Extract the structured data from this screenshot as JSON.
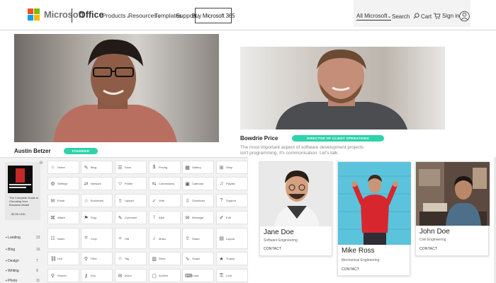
{
  "header": {
    "brand": "Microsoft",
    "office": "Office",
    "nav": [
      "Products",
      "Resources",
      "Templates",
      "Support"
    ],
    "buy": "Buy Microsoft 365",
    "right": [
      "All Microsoft",
      "Search",
      "Cart",
      "Sign in"
    ],
    "logo_colors": [
      "#f25022",
      "#7fba00",
      "#00a4ef",
      "#ffb900"
    ]
  },
  "team": {
    "member1": {
      "name": "Austin Betzer",
      "badge": "FOUNDER"
    },
    "member2": {
      "name": "Bowdrie Price",
      "badge": "DIRECTOR OF CLIENT OPERATIONS",
      "desc": "The most important aspect of software development projects isn't programming, it's communication. Let's talk."
    },
    "accent": "#2ed3a9"
  },
  "dock": {
    "book_title": "LEARN TO CHOOSE THE RIGHT MODEL FOR YOUR BUSINESS",
    "book_desc": "The Complete Guide to Choosing Your Business Model",
    "book_price": "$3.99 USD",
    "sidebar": [
      {
        "label": "Landing",
        "count": "22"
      },
      {
        "label": "Blog",
        "count": "15"
      },
      {
        "label": "Design",
        "count": "7"
      },
      {
        "label": "Writing",
        "count": "9"
      },
      {
        "label": "Photo",
        "count": "11"
      }
    ],
    "tiles": [
      [
        "Home",
        "Blog",
        "Docs",
        "Pricing",
        "Gallery",
        "Shop"
      ],
      [
        "Settings",
        "Network",
        "Profile",
        "Connections",
        "Calendar",
        "Playlist"
      ],
      [
        "Email",
        "Bookmark",
        "Upload",
        "Vote",
        "Download",
        "Support"
      ],
      [
        "Attach",
        "Flag",
        "Comment",
        "Alert",
        "Message",
        "Edit"
      ],
      [
        "Notes",
        "Crop",
        "Gift",
        "Music",
        "Share",
        "Layout"
      ],
      [
        "Link",
        "Filter",
        "Tag",
        "Store",
        "Graph",
        "Trophy"
      ],
      [
        "Search",
        "Key",
        "Inbox",
        "Archive",
        "Code",
        "Lock"
      ]
    ]
  },
  "cards": [
    {
      "name": "Jane Doe",
      "role": "Software Engineering",
      "cta": "CONTACT"
    },
    {
      "name": "Mike Ross",
      "role": "Mechanical Engineering",
      "cta": "CONTACT"
    },
    {
      "name": "John Doe",
      "role": "Civil Engineering",
      "cta": "CONTACT"
    }
  ]
}
